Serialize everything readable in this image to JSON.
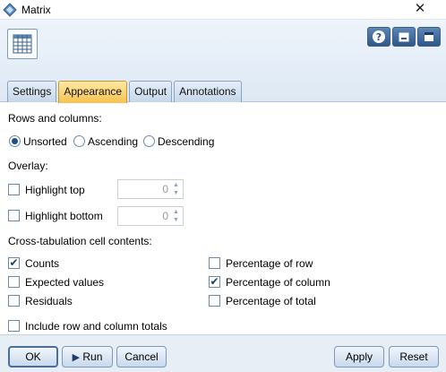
{
  "window": {
    "title": "Matrix",
    "close_icon": "close-icon"
  },
  "tabs": [
    {
      "label": "Settings",
      "active": false
    },
    {
      "label": "Appearance",
      "active": true
    },
    {
      "label": "Output",
      "active": false
    },
    {
      "label": "Annotations",
      "active": false
    }
  ],
  "appearance": {
    "rows_label": "Rows and columns:",
    "sort_options": [
      {
        "label": "Unsorted",
        "checked": true
      },
      {
        "label": "Ascending",
        "checked": false
      },
      {
        "label": "Descending",
        "checked": false
      }
    ],
    "overlay_label": "Overlay:",
    "highlight_top": {
      "label": "Highlight top",
      "checked": false,
      "value": "0"
    },
    "highlight_bottom": {
      "label": "Highlight bottom",
      "checked": false,
      "value": "0"
    },
    "cell_contents_label": "Cross-tabulation cell contents:",
    "left_options": [
      {
        "label": "Counts",
        "checked": true
      },
      {
        "label": "Expected values",
        "checked": false
      },
      {
        "label": "Residuals",
        "checked": false
      }
    ],
    "right_options": [
      {
        "label": "Percentage of row",
        "checked": false
      },
      {
        "label": "Percentage of column",
        "checked": true
      },
      {
        "label": "Percentage of total",
        "checked": false
      }
    ],
    "include_totals": {
      "label": "Include row and column totals",
      "checked": false
    }
  },
  "footer": {
    "ok": "OK",
    "run": "Run",
    "cancel": "Cancel",
    "apply": "Apply",
    "reset": "Reset"
  },
  "colors": {
    "accent": "#f8c24e",
    "header_bg": "#dde8f4",
    "radio_fill": "#1d4f8e"
  }
}
